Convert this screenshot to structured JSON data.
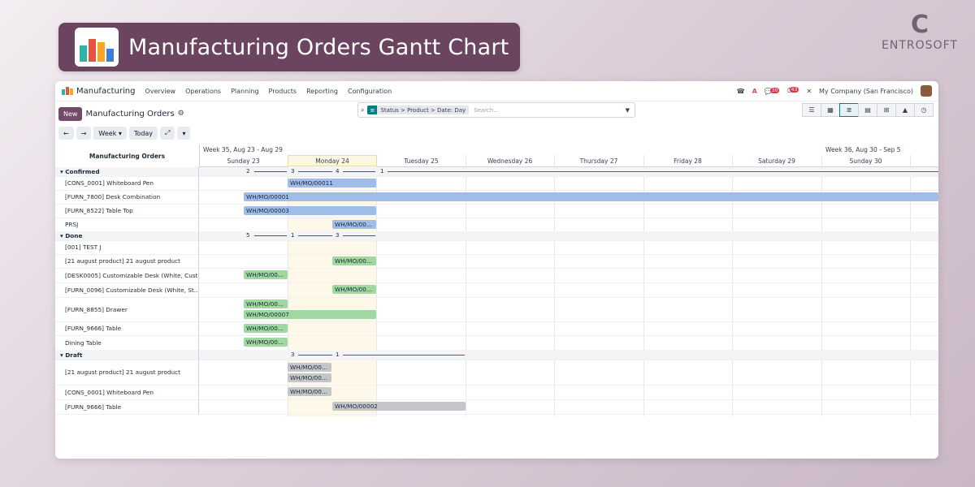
{
  "banner": {
    "title": "Manufacturing Orders Gantt Chart"
  },
  "brand": {
    "mark": "C",
    "word": "ENTROSOFT"
  },
  "topnav": {
    "app": "Manufacturing",
    "items": [
      "Overview",
      "Operations",
      "Planning",
      "Products",
      "Reporting",
      "Configuration"
    ],
    "badge_messages": "30",
    "badge_activities": "43",
    "company": "My Company (San Francisco)"
  },
  "control": {
    "new_label": "New",
    "title": "Manufacturing Orders",
    "facet": "Status > Product > Date: Day",
    "search_placeholder": "Search..."
  },
  "toolbar": {
    "prev": "←",
    "next": "→",
    "scale": "Week",
    "today": "Today",
    "expand": "⤢",
    "more": "▾"
  },
  "gantt": {
    "header_label": "Manufacturing Orders",
    "weeks": [
      "Week 35, Aug 23 - Aug 29",
      "Week 36, Aug 30 - Sep 5"
    ],
    "days": [
      "Sunday 23",
      "Monday 24",
      "Tuesday 25",
      "Wednesday 26",
      "Thursday 27",
      "Friday 28",
      "Saturday 29",
      "Sunday 30"
    ],
    "groups": [
      {
        "name": "Confirmed",
        "counts": [
          "2",
          "3",
          "4",
          "1"
        ]
      },
      {
        "name": "Done",
        "counts": [
          "5",
          "1",
          "3"
        ]
      },
      {
        "name": "Draft",
        "counts": [
          "3",
          "1"
        ]
      }
    ],
    "rows": [
      "[CONS_0001] Whiteboard Pen",
      "[FURN_7800] Desk Combination",
      "[FURN_8522] Table Top",
      "PRSJ",
      "[001] TEST J",
      "[21 august product] 21 august product",
      "[DESK0005] Customizable Desk (White, Cust...",
      "[FURN_0096] Customizable Desk (White, St...",
      "[FURN_8855] Drawer",
      "[FURN_9666] Table",
      "Dining Table",
      "[21 august product] 21 august product",
      "[CONS_0001] Whiteboard Pen",
      "[FURN_9666] Table"
    ],
    "bars": [
      "WH/MO/00011",
      "WH/MO/00001",
      "WH/MO/00003",
      "WH/MO/00...",
      "WH/MO/00...",
      "WH/MO/00...",
      "WH/MO/00...",
      "WH/MO/00...",
      "WH/MO/00007",
      "WH/MO/00...",
      "WH/MO/00...",
      "WH/MO/00...",
      "WH/MO/00...",
      "WH/MO/00...",
      "WH/MO/00002"
    ]
  }
}
